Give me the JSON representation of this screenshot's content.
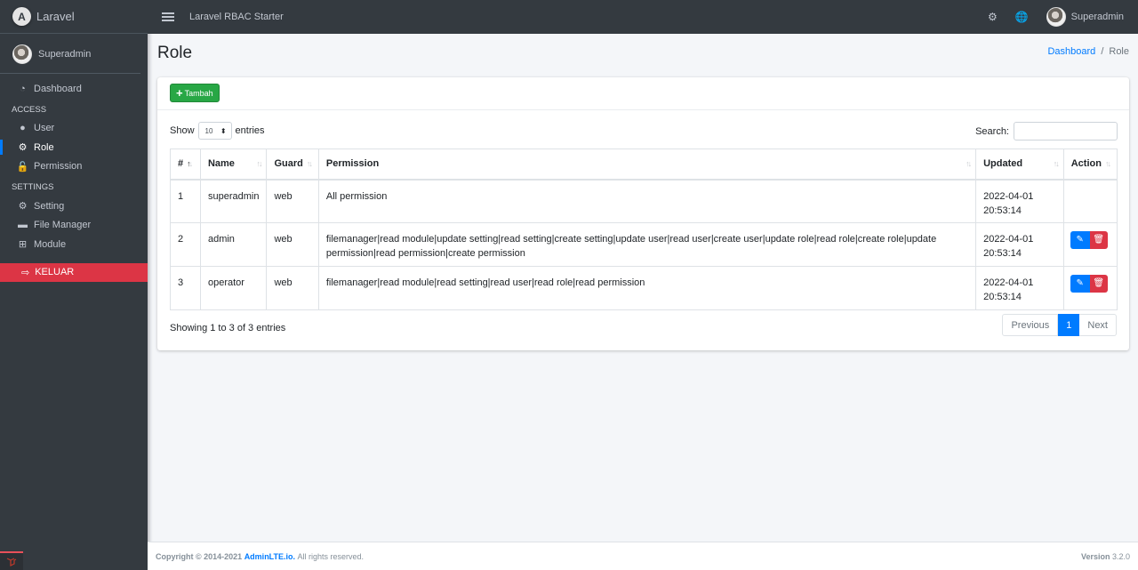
{
  "brand": {
    "logo_letter": "A",
    "name": "Laravel"
  },
  "sidebar": {
    "user_name": "Superadmin",
    "items": [
      {
        "type": "item",
        "label": "Dashboard",
        "icon": "tachometer-icon",
        "glyph": "◔",
        "active": false
      },
      {
        "type": "header",
        "label": "ACCESS"
      },
      {
        "type": "item",
        "label": "User",
        "icon": "user-icon",
        "glyph": "●",
        "active": false
      },
      {
        "type": "item",
        "label": "Role",
        "icon": "user-cog-icon",
        "glyph": "⚙",
        "active": true
      },
      {
        "type": "item",
        "label": "Permission",
        "icon": "unlock-icon",
        "glyph": "🔓",
        "active": false
      },
      {
        "type": "header",
        "label": "SETTINGS"
      },
      {
        "type": "item",
        "label": "Setting",
        "icon": "cog-icon",
        "glyph": "⚙",
        "active": false
      },
      {
        "type": "item",
        "label": "File Manager",
        "icon": "folder-icon",
        "glyph": "▬",
        "active": false
      },
      {
        "type": "item",
        "label": "Module",
        "icon": "sitemap-icon",
        "glyph": "⊞",
        "active": false
      }
    ],
    "logout_label": "KELUAR",
    "logout_glyph": "⇨"
  },
  "topbar": {
    "app_title": "Laravel RBAC Starter",
    "settings_glyph": "⚙",
    "language_glyph": "🌐",
    "user_name": "Superadmin"
  },
  "page": {
    "title": "Role",
    "breadcrumb": [
      {
        "label": "Dashboard",
        "link": true
      },
      {
        "label": "Role",
        "link": false
      }
    ],
    "breadcrumb_separator": "/"
  },
  "card": {
    "add_button_icon": "+",
    "add_button_label": "Tambah",
    "show_label": "Show",
    "entries_label": "entries",
    "page_length": "10",
    "search_label": "Search:",
    "search_value": "",
    "columns": [
      {
        "label": "#",
        "sorted": "asc"
      },
      {
        "label": "Name",
        "sorted": "none"
      },
      {
        "label": "Guard",
        "sorted": "none"
      },
      {
        "label": "Permission",
        "sorted": "none"
      },
      {
        "label": "Updated",
        "sorted": "none"
      },
      {
        "label": "Action",
        "sorted": "none"
      }
    ],
    "rows": [
      {
        "no": "1",
        "name": "superadmin",
        "guard": "web",
        "permission": "All permission",
        "updated_date": "2022-04-01",
        "updated_time": "20:53:14",
        "has_actions": false
      },
      {
        "no": "2",
        "name": "admin",
        "guard": "web",
        "permission": "filemanager|read module|update setting|read setting|create setting|update user|read user|create user|update role|read role|create role|update permission|read permission|create permission",
        "updated_date": "2022-04-01",
        "updated_time": "20:53:14",
        "has_actions": true
      },
      {
        "no": "3",
        "name": "operator",
        "guard": "web",
        "permission": "filemanager|read module|read setting|read user|read role|read permission",
        "updated_date": "2022-04-01",
        "updated_time": "20:53:14",
        "has_actions": true
      }
    ],
    "info": "Showing 1 to 3 of 3 entries",
    "pagination": {
      "previous": "Previous",
      "current": "1",
      "next": "Next"
    }
  },
  "footer": {
    "copyright_prefix": "Copyright © 2014-2021",
    "copyright_link": "AdminLTE.io.",
    "copyright_suffix": "All rights reserved.",
    "version_label": "Version",
    "version_value": "3.2.0"
  },
  "colors": {
    "primary": "#007bff",
    "success": "#28a745",
    "danger": "#dc3545",
    "sidebar": "#343a40"
  }
}
